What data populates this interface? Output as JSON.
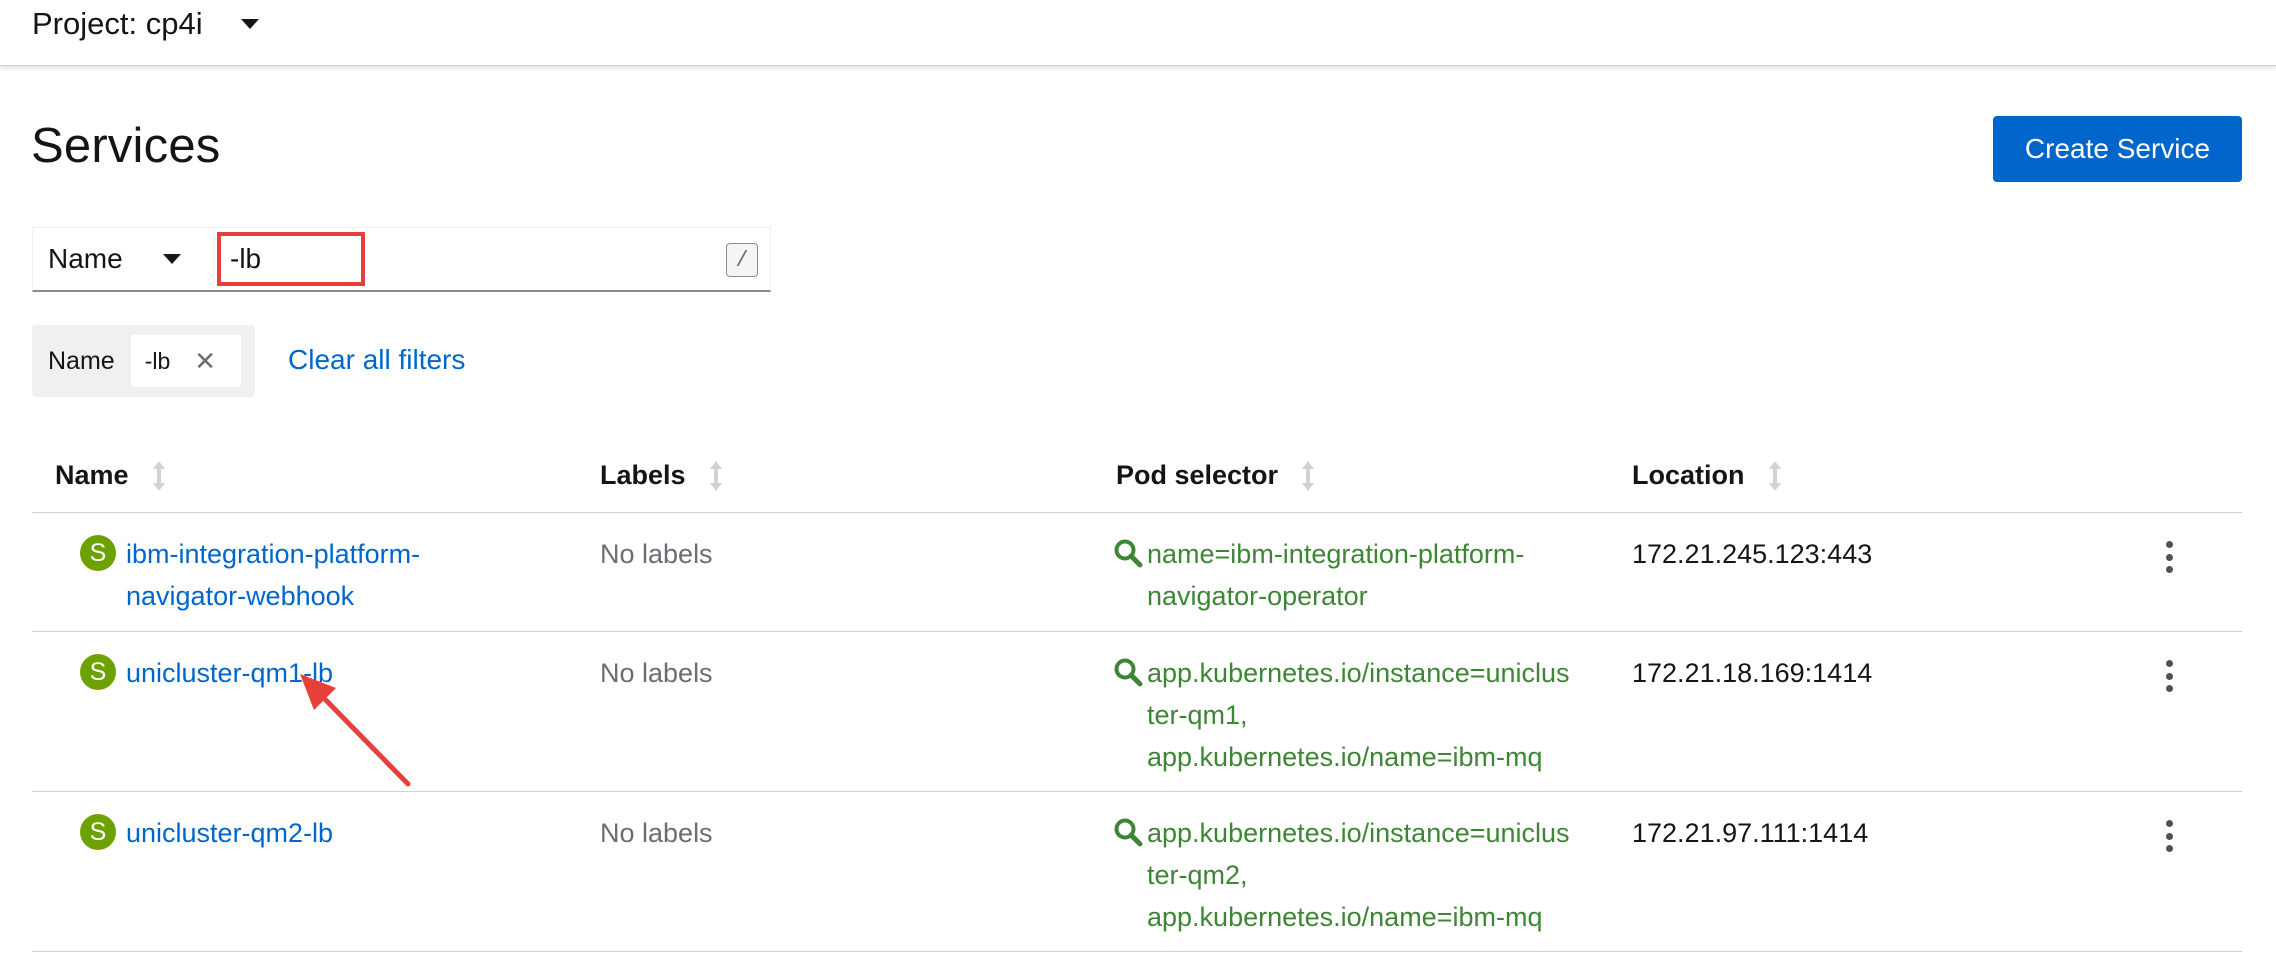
{
  "project": {
    "label": "Project: cp4i"
  },
  "page": {
    "title": "Services",
    "create_button": "Create Service"
  },
  "filter": {
    "type": "Name",
    "value": "-lb",
    "shortcut": "/"
  },
  "chips": {
    "category": "Name",
    "value": "-lb",
    "clear_label": "Clear all filters"
  },
  "table": {
    "columns": [
      "Name",
      "Labels",
      "Pod selector",
      "Location"
    ],
    "rows": [
      {
        "badge": "S",
        "name_lines": [
          "ibm-integration-platform-",
          "navigator-webhook"
        ],
        "labels": "No labels",
        "selector_lines": [
          "name=ibm-integration-platform-",
          "navigator-operator"
        ],
        "location": "172.21.245.123:443"
      },
      {
        "badge": "S",
        "name_lines": [
          "unicluster-qm1-lb"
        ],
        "labels": "No labels",
        "selector_lines": [
          "app.kubernetes.io/instance=uniclus",
          "ter-qm1,",
          "app.kubernetes.io/name=ibm-mq"
        ],
        "location": "172.21.18.169:1414"
      },
      {
        "badge": "S",
        "name_lines": [
          "unicluster-qm2-lb"
        ],
        "labels": "No labels",
        "selector_lines": [
          "app.kubernetes.io/instance=uniclus",
          "ter-qm2,",
          "app.kubernetes.io/name=ibm-mq"
        ],
        "location": "172.21.97.111:1414"
      }
    ]
  },
  "icons": {
    "project_dropdown": "caret-down-icon",
    "filter_dropdown": "caret-down-icon",
    "chip_remove": "close-icon",
    "sort": "sort-icon",
    "resource_badge": "service-badge-icon",
    "selector": "search-icon",
    "row_actions": "kebab-menu-icon"
  },
  "colors": {
    "primary": "#0066cc",
    "badge": "#6ca100",
    "selector_link": "#3e8635",
    "annotation": "#e5403a"
  }
}
